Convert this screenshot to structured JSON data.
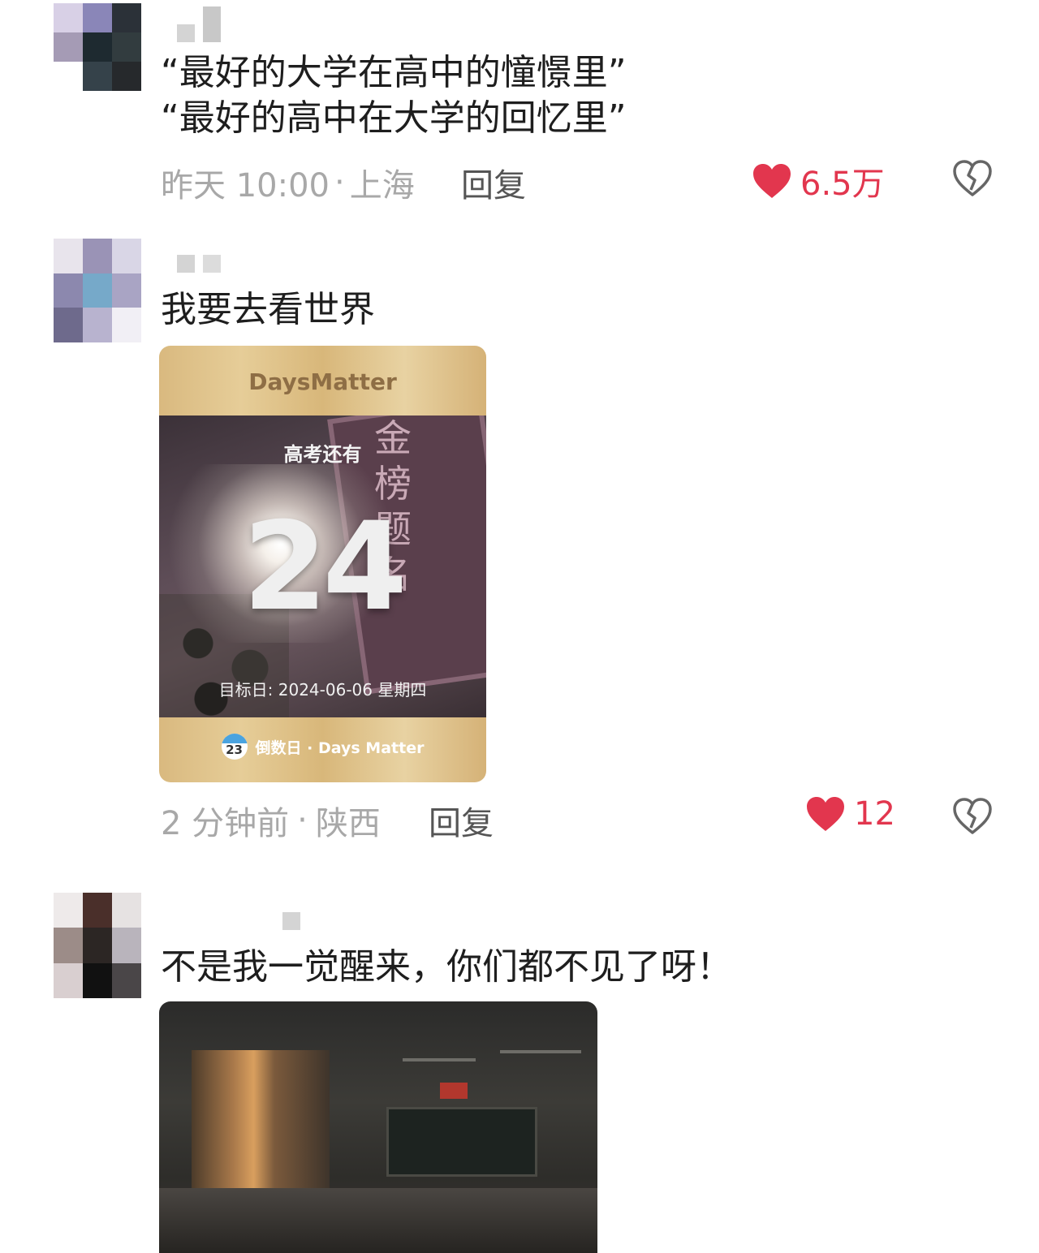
{
  "comments": [
    {
      "text": "“最好的大学在高中的憧憬里”\n“最好的高中在大学的回忆里”",
      "time": "昨天 10:00",
      "location": "上海",
      "reply_label": "回复",
      "likes": "6.5万"
    },
    {
      "text": "我要去看世界",
      "time": "2 分钟前",
      "location": "陕西",
      "reply_label": "回复",
      "likes": "12",
      "card": {
        "brand": "DaysMatter",
        "label": "高考还有",
        "days": "24",
        "sign_text": "金榜题名",
        "target": "目标日: 2024-06-06 星期四",
        "calendar_day": "23",
        "footer": "倒数日 · Days Matter"
      }
    },
    {
      "text": "不是我一觉醒来，你们都不见了呀！"
    }
  ],
  "meta_separator": "·",
  "colors": {
    "like": "#e2364e",
    "meta": "#a8a8a8"
  },
  "icons": {
    "like": "heart-icon",
    "dislike": "broken-heart-icon"
  }
}
